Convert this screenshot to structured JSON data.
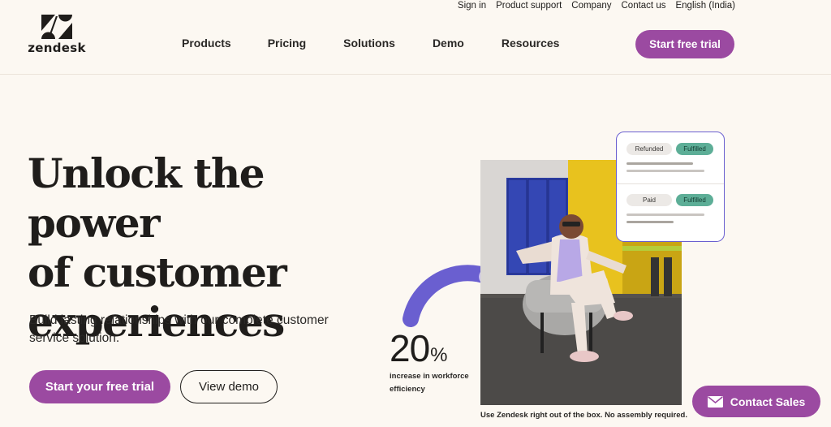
{
  "brand": {
    "name": "zendesk",
    "accent": "#9b4aa1",
    "background": "#fcf8f2"
  },
  "util_nav": [
    "Sign in",
    "Product support",
    "Company",
    "Contact us",
    "English (India)"
  ],
  "main_nav": [
    "Products",
    "Pricing",
    "Solutions",
    "Demo",
    "Resources"
  ],
  "header": {
    "cta_label": "Start free trial"
  },
  "hero": {
    "headline_line1": "Unlock the power",
    "headline_line2": "of customer",
    "headline_line3": "experiences",
    "subtext": "Build lasting relationships with our complete customer service solution.",
    "primary_cta": "Start your free trial",
    "secondary_cta": "View demo"
  },
  "stat": {
    "value": "20",
    "unit": "%",
    "label": "increase in workforce efficiency"
  },
  "card": {
    "row1": {
      "left": "Refunded",
      "right": "Fulfilled"
    },
    "row2": {
      "left": "Paid",
      "right": "Fulfilled"
    }
  },
  "caption": "Use Zendesk right out of the box. No assembly required.",
  "contact_sales": {
    "label": "Contact Sales",
    "icon": "mail-icon"
  }
}
